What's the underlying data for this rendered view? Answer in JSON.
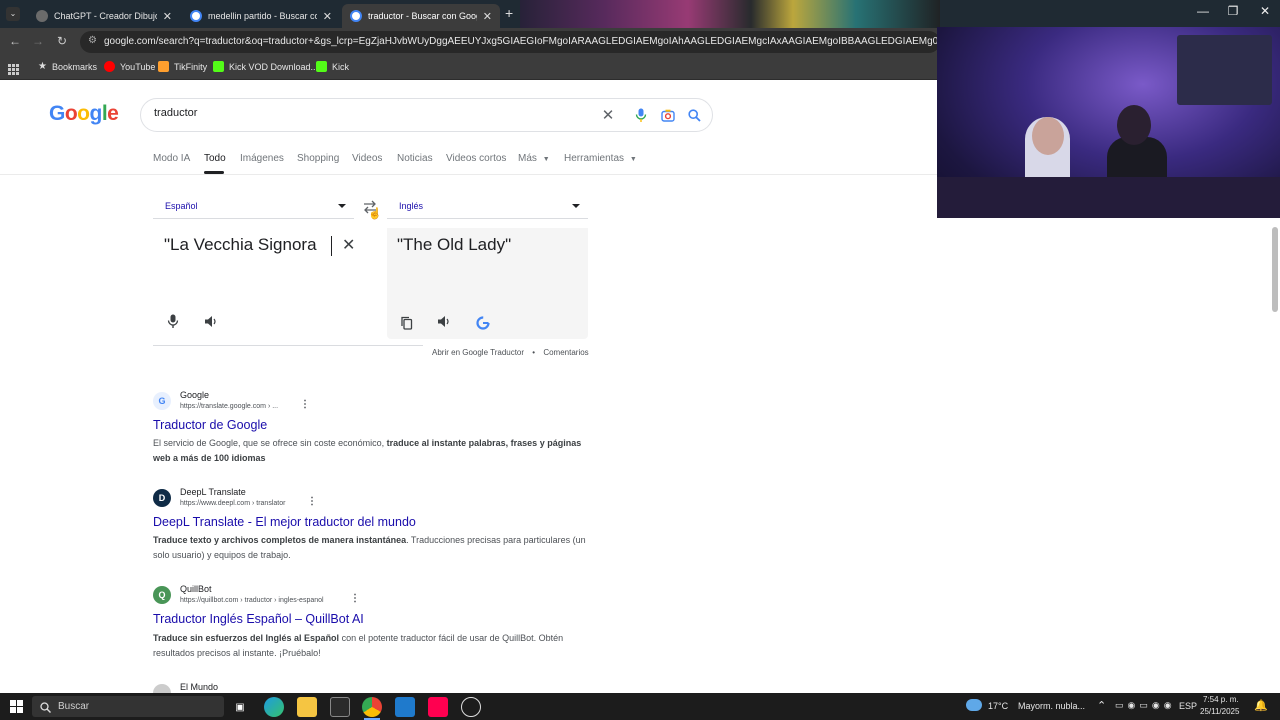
{
  "browser": {
    "tabs": [
      {
        "label": "ChatGPT - Creador Dibujo",
        "close": "✕"
      },
      {
        "label": "medellin partido - Buscar con G",
        "close": "✕"
      },
      {
        "label": "traductor - Buscar con Google",
        "close": "✕"
      }
    ],
    "new_tab": "+",
    "window_controls": {
      "minimize": "—",
      "restore": "❐",
      "close": "✕"
    },
    "url": "google.com/search?q=traductor&oq=traductor+&gs_lcrp=EgZjaHJvbWUyDggAEEUYJxg5GIAEGIoFMgoIARAAGLEDGIAEMgoIAhAAGLEDGIAEMgcIAxAAGIAEMgoIBBAAGLEDGIAEMg0IBRAAGIMBGLEDGIA",
    "bookmarks": [
      {
        "label": "Bookmarks",
        "color": "#dddddd"
      },
      {
        "label": "YouTube",
        "color": "#ff0000"
      },
      {
        "label": "TikFinity",
        "color": "#ff9f2e"
      },
      {
        "label": "Kick VOD Download...",
        "color": "#53fc18"
      },
      {
        "label": "Kick",
        "color": "#53fc18"
      }
    ]
  },
  "google": {
    "logo": "Google",
    "query": "traductor",
    "nav_tabs": [
      "Modo IA",
      "Todo",
      "Imágenes",
      "Shopping",
      "Videos",
      "Noticias",
      "Videos cortos",
      "Más",
      "Herramientas"
    ],
    "active_tab": "Todo"
  },
  "translator": {
    "source_lang": "Español",
    "target_lang": "Inglés",
    "source_text": "\"La Vecchia Signora",
    "translated_text": "\"The Old Lady\"",
    "open_link": "Abrir en Google Traductor",
    "separator": "•",
    "feedback_link": "Comentarios"
  },
  "results": [
    {
      "site": "Google",
      "url": "https://translate.google.com › ...",
      "title": "Traductor de Google",
      "snippet_plain": "El servicio de Google, que se ofrece sin coste económico, ",
      "snippet_bold": "traduce al instante palabras, frases y páginas web a más de 100 idiomas",
      "snippet_tail": "",
      "fav_color": "#4285f4",
      "fav_letter": "G"
    },
    {
      "site": "DeepL Translate",
      "url": "https://www.deepl.com › translator",
      "title": "DeepL Translate - El mejor traductor del mundo",
      "snippet_plain": "",
      "snippet_bold": "Traduce texto y archivos completos de manera instantánea",
      "snippet_tail": ". Traducciones precisas para particulares (un solo usuario) y equipos de trabajo.",
      "fav_color": "#0f2b46",
      "fav_letter": "D"
    },
    {
      "site": "QuillBot",
      "url": "https://quillbot.com › traductor › ingles-espanol",
      "title": "Traductor Inglés Español – QuillBot AI",
      "snippet_plain": "",
      "snippet_bold": "Traduce sin esfuerzos del Inglés al Español",
      "snippet_tail": " con el potente traductor fácil de usar de QuillBot. Obtén resultados precisos al instante. ¡Pruébalo!",
      "fav_color": "#499557",
      "fav_letter": "Q"
    },
    {
      "site": "El Mundo",
      "url": "",
      "title": "",
      "snippet_plain": "",
      "snippet_bold": "",
      "snippet_tail": "",
      "fav_color": "#cccccc",
      "fav_letter": ""
    }
  ],
  "taskbar": {
    "search_label": "Buscar",
    "weather_temp": "17°C",
    "weather_desc": "Mayorm. nubla...",
    "language": "ESP",
    "time": "7:54 p. m.",
    "date": "25/11/2025"
  }
}
